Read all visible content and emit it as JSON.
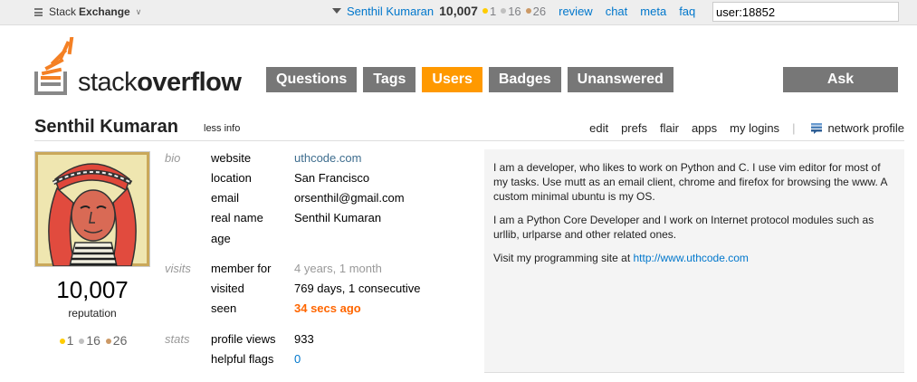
{
  "topbar": {
    "brand_light": "Stack",
    "brand_bold": "Exchange",
    "brand_chevron": "∨",
    "user_name": "Senthil Kumaran",
    "user_rep": "10,007",
    "badges": {
      "gold": "1",
      "silver": "16",
      "bronze": "26"
    },
    "links": [
      "review",
      "chat",
      "meta",
      "faq"
    ],
    "search_value": "user:18852"
  },
  "logo": {
    "light": "stack",
    "bold": "overflow"
  },
  "nav": {
    "items": [
      "Questions",
      "Tags",
      "Users",
      "Badges",
      "Unanswered"
    ],
    "active": "Users",
    "ask": "Ask Question"
  },
  "profile": {
    "name": "Senthil Kumaran",
    "less_info": "less info",
    "tabs": [
      "edit",
      "prefs",
      "flair",
      "apps",
      "my logins"
    ],
    "separator": "|",
    "network_profile": "network profile",
    "reputation": "10,007",
    "reputation_label": "reputation",
    "badges": {
      "gold": "1",
      "silver": "16",
      "bronze": "26"
    },
    "bio_group": "bio",
    "visits_group": "visits",
    "stats_group": "stats",
    "fields": {
      "website": {
        "key": "website",
        "value": "uthcode.com"
      },
      "location": {
        "key": "location",
        "value": "San Francisco"
      },
      "email": {
        "key": "email",
        "value": "orsenthil@gmail.com"
      },
      "real_name": {
        "key": "real name",
        "value": "Senthil Kumaran"
      },
      "age": {
        "key": "age",
        "value": ""
      },
      "member_for": {
        "key": "member for",
        "value": "4 years, 1 month"
      },
      "visited": {
        "key": "visited",
        "value": "769 days, 1 consecutive"
      },
      "seen": {
        "key": "seen",
        "value": "34 secs ago"
      },
      "profile_views": {
        "key": "profile views",
        "value": "933"
      },
      "helpful_flags": {
        "key": "helpful flags",
        "value": "0"
      }
    }
  },
  "about": {
    "p1": "I am a developer, who likes to work on Python and C. I use vim editor for most of my tasks. Use mutt as an email client, chrome and firefox for browsing the www. A custom minimal ubuntu is my OS.",
    "p2": "I am a Python Core Developer and I work on Internet protocol modules such as urllib, urlparse and other related ones.",
    "p3_text": "Visit my programming site at ",
    "p3_link": "http://www.uthcode.com"
  },
  "colors": {
    "accent": "#ff9900",
    "nav": "#777777",
    "link": "#0077cc"
  }
}
